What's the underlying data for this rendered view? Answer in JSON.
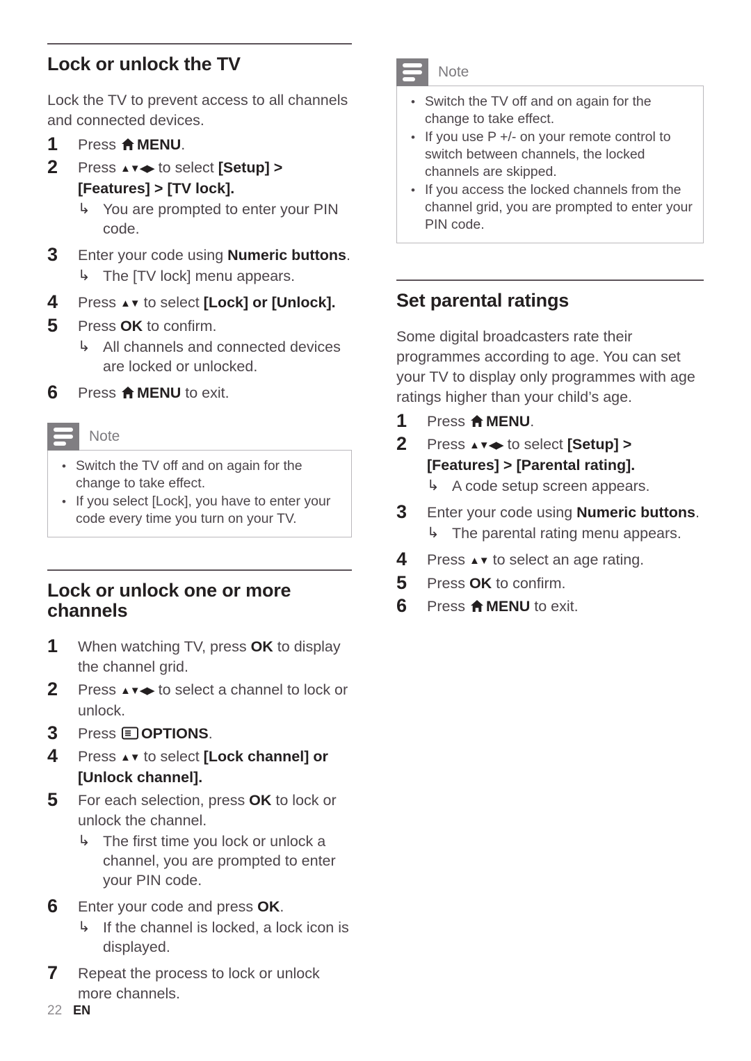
{
  "document": {
    "footer": {
      "page_number": "22",
      "language": "EN"
    }
  },
  "left_column": {
    "section1": {
      "heading": "Lock or unlock the TV",
      "intro": "Lock the TV to prevent access to all channels and connected devices.",
      "steps": [
        {
          "num": "1",
          "text_before": "Press ",
          "icon": "home-icon",
          "bold": "MENU",
          "text_after": "."
        },
        {
          "num": "2",
          "text_before": "Press ",
          "icon": "nav-arrows-icon",
          "text_mid": " to select ",
          "bold": "[Setup]",
          "text_after": " > [Features] > [TV lock].",
          "results": [
            "You are prompted to enter your PIN code."
          ]
        },
        {
          "num": "3",
          "text_before": "Enter your code using ",
          "bold": "Numeric buttons",
          "text_after": ".",
          "results": [
            "The [TV lock] menu appears."
          ]
        },
        {
          "num": "4",
          "text_before": "Press ",
          "icon": "updown-arrows-icon",
          "text_mid": " to select ",
          "bold": "[Lock]",
          "text_after": " or [Unlock]."
        },
        {
          "num": "5",
          "text_before": "Press ",
          "bold": "OK",
          "text_after": " to confirm.",
          "results": [
            "All channels and connected devices are locked or unlocked."
          ]
        },
        {
          "num": "6",
          "text_before": "Press ",
          "icon": "home-icon",
          "bold": "MENU",
          "text_after": " to exit."
        }
      ],
      "note": {
        "title": "Note",
        "icon": "note-icon",
        "bullets": [
          "Switch the TV off and on again for the change to take effect.",
          "If you select [Lock], you have to enter your code every time you turn on your TV."
        ]
      }
    },
    "section2": {
      "heading": "Lock or unlock one or more channels",
      "steps": [
        {
          "num": "1",
          "text_before": "When watching TV, press ",
          "bold": "OK",
          "text_after": " to display the channel grid."
        },
        {
          "num": "2",
          "text_before": "Press ",
          "icon": "nav-arrows-icon",
          "text_mid": " to select a channel to lock or unlock."
        },
        {
          "num": "3",
          "text_before": "Press ",
          "icon": "options-icon",
          "bold": "OPTIONS",
          "text_after": "."
        },
        {
          "num": "4",
          "text_before": "Press ",
          "icon": "updown-arrows-icon",
          "text_mid": " to select ",
          "bold": "[Lock channel]",
          "text_after": " or [Unlock channel]."
        },
        {
          "num": "5",
          "text_before": "For each selection, press ",
          "bold": "OK",
          "text_after": " to lock or unlock the channel.",
          "results": [
            "The first time you lock or unlock a channel, you are prompted to enter your PIN code."
          ]
        },
        {
          "num": "6",
          "text_before": "Enter your code and press ",
          "bold": "OK",
          "text_after": ".",
          "results": [
            "If the channel is locked, a lock icon is displayed."
          ]
        },
        {
          "num": "7",
          "text_before": "Repeat the process to lock or unlock more channels."
        }
      ]
    }
  },
  "right_column": {
    "note_top": {
      "title": "Note",
      "icon": "note-icon",
      "bullets": [
        "Switch the TV off and on again for the change to take effect.",
        "If you use P +/- on your remote control to switch between channels, the locked channels are skipped.",
        "If you access the locked channels from the channel grid, you are prompted to enter your PIN code."
      ]
    },
    "section1": {
      "heading": "Set parental ratings",
      "intro": "Some digital broadcasters rate their programmes according to age. You can set your TV to display only programmes with age ratings higher than your child’s age.",
      "steps": [
        {
          "num": "1",
          "text_before": "Press ",
          "icon": "home-icon",
          "bold": "MENU",
          "text_after": "."
        },
        {
          "num": "2",
          "text_before": "Press ",
          "icon": "nav-arrows-icon",
          "text_mid": " to select ",
          "bold": "[Setup]",
          "text_after": " > [Features] > [Parental rating].",
          "results": [
            "A code setup screen appears."
          ]
        },
        {
          "num": "3",
          "text_before": "Enter your code using ",
          "bold": "Numeric buttons",
          "text_after": ".",
          "results": [
            "The parental rating menu appears."
          ]
        },
        {
          "num": "4",
          "text_before": "Press ",
          "icon": "updown-arrows-icon",
          "text_mid": " to select an age rating."
        },
        {
          "num": "5",
          "text_before": "Press ",
          "bold": "OK",
          "text_after": " to confirm."
        },
        {
          "num": "6",
          "text_before": "Press ",
          "icon": "home-icon",
          "bold": "MENU",
          "text_after": " to exit."
        }
      ]
    }
  },
  "glyphs": {
    "nav_arrows": "▲▼◀▶",
    "updown_arrows": "▲▼",
    "result_arrow": "↳",
    "bullet": "•"
  },
  "colors": {
    "heading": "#231f20",
    "body": "#4b4449",
    "note_icon_bg": "#807e82",
    "note_title": "#7c7a7e",
    "note_border": "#b9b7bb",
    "rule": "#5b5258"
  }
}
